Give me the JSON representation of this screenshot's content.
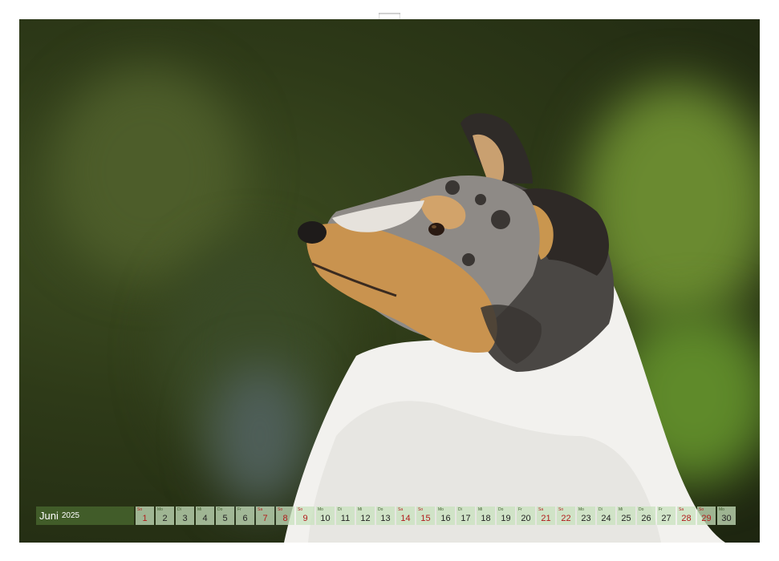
{
  "calendar": {
    "month": "Juni",
    "year": "2025",
    "days": [
      {
        "dn": "So",
        "num": "1",
        "red": true
      },
      {
        "dn": "Mo",
        "num": "2",
        "red": false
      },
      {
        "dn": "Di",
        "num": "3",
        "red": false
      },
      {
        "dn": "Mi",
        "num": "4",
        "red": false
      },
      {
        "dn": "Do",
        "num": "5",
        "red": false
      },
      {
        "dn": "Fr",
        "num": "6",
        "red": false
      },
      {
        "dn": "Sa",
        "num": "7",
        "red": true
      },
      {
        "dn": "So",
        "num": "8",
        "red": true
      },
      {
        "dn": "So",
        "num": "9",
        "red": true
      },
      {
        "dn": "Mo",
        "num": "10",
        "red": false
      },
      {
        "dn": "Di",
        "num": "11",
        "red": false
      },
      {
        "dn": "Mi",
        "num": "12",
        "red": false
      },
      {
        "dn": "Do",
        "num": "13",
        "red": false
      },
      {
        "dn": "Sa",
        "num": "14",
        "red": true
      },
      {
        "dn": "So",
        "num": "15",
        "red": true
      },
      {
        "dn": "Mo",
        "num": "16",
        "red": false
      },
      {
        "dn": "Di",
        "num": "17",
        "red": false
      },
      {
        "dn": "Mi",
        "num": "18",
        "red": false
      },
      {
        "dn": "Do",
        "num": "19",
        "red": false
      },
      {
        "dn": "Fr",
        "num": "20",
        "red": false
      },
      {
        "dn": "Sa",
        "num": "21",
        "red": true
      },
      {
        "dn": "So",
        "num": "22",
        "red": true
      },
      {
        "dn": "Mo",
        "num": "23",
        "red": false
      },
      {
        "dn": "Di",
        "num": "24",
        "red": false
      },
      {
        "dn": "Mi",
        "num": "25",
        "red": false
      },
      {
        "dn": "Do",
        "num": "26",
        "red": false
      },
      {
        "dn": "Fr",
        "num": "27",
        "red": false
      },
      {
        "dn": "Sa",
        "num": "28",
        "red": true
      },
      {
        "dn": "So",
        "num": "29",
        "red": true
      },
      {
        "dn": "Mo",
        "num": "30",
        "red": false
      }
    ]
  }
}
